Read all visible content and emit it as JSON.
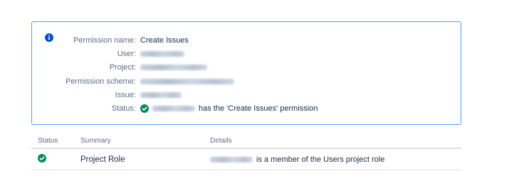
{
  "panel": {
    "icon": "info-icon",
    "rows": [
      {
        "label": "Permission name:",
        "value": "Create Issues"
      },
      {
        "label": "User:"
      },
      {
        "label": "Project:"
      },
      {
        "label": "Permission scheme:"
      },
      {
        "label": "Issue:"
      },
      {
        "label": "Status:",
        "status_icon": "check-circle-icon",
        "value": "has the 'Create Issues' permission"
      }
    ]
  },
  "table": {
    "headers": {
      "status": "Status",
      "summary": "Summary",
      "details": "Details"
    },
    "rows": [
      {
        "status_icon": "check-circle-icon",
        "summary": "Project Role",
        "details": "is a member of the Users project role"
      }
    ]
  },
  "colors": {
    "panel_border": "#4c9aff",
    "info_icon": "#0052cc",
    "success": "#00875a",
    "label": "#5e6c84",
    "text": "#172b4d"
  }
}
